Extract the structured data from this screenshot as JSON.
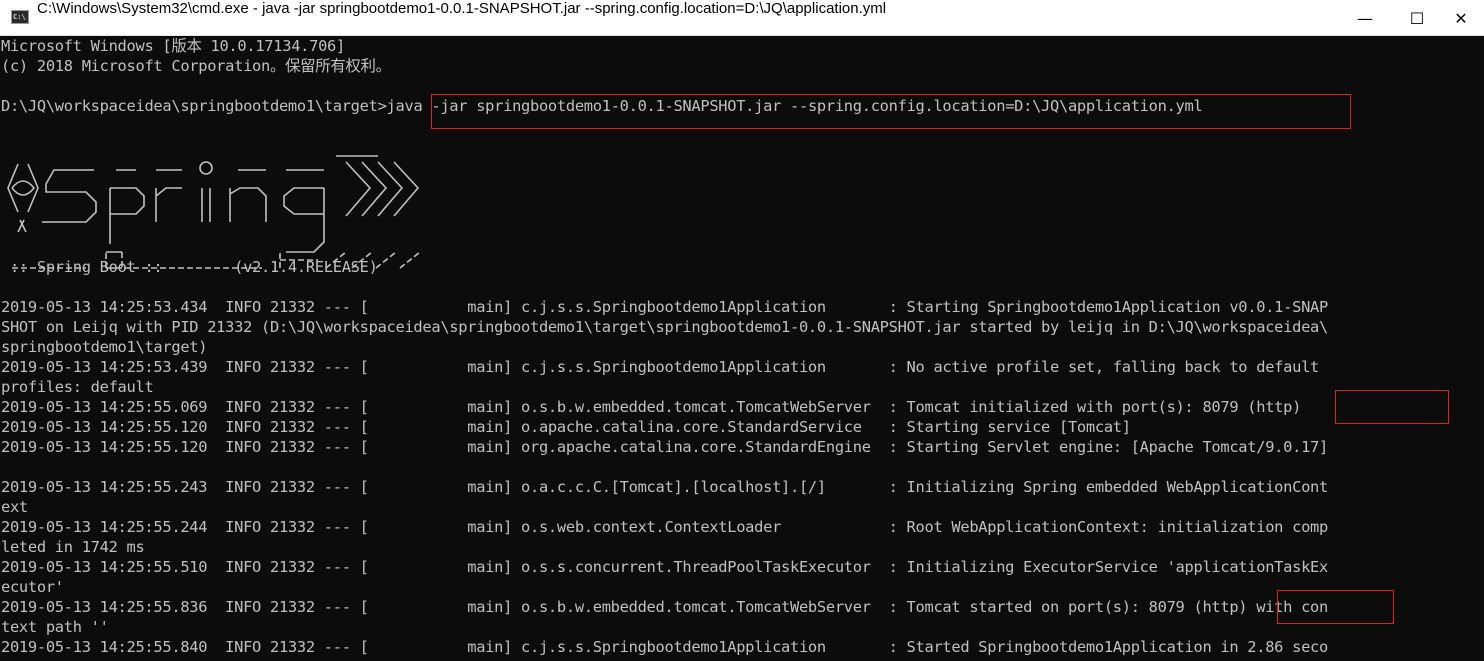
{
  "window": {
    "title": "C:\\Windows\\System32\\cmd.exe - java  -jar springbootdemo1-0.0.1-SNAPSHOT.jar --spring.config.location=D:\\JQ\\application.yml",
    "icon": "cmd-icon",
    "controls": {
      "minimize": "—",
      "maximize": "☐",
      "close": "✕"
    }
  },
  "console": {
    "header": [
      "Microsoft Windows [版本 10.0.17134.706]",
      "(c) 2018 Microsoft Corporation。保留所有权利。"
    ],
    "prompt": "D:\\JQ\\workspaceidea\\springbootdemo1\\target>",
    "command": "java -jar springbootdemo1-0.0.1-SNAPSHOT.jar --spring.config.location=D:\\JQ\\application.yml",
    "banner_footer": " :: Spring Boot ::        (v2.1.4.RELEASE)",
    "log_lines": [
      "2019-05-13 14:25:53.434  INFO 21332 --- [           main] c.j.s.s.Springbootdemo1Application       : Starting Springbootdemo1Application v0.0.1-SNAP",
      "SHOT on Leijq with PID 21332 (D:\\JQ\\workspaceidea\\springbootdemo1\\target\\springbootdemo1-0.0.1-SNAPSHOT.jar started by leijq in D:\\JQ\\workspaceidea\\",
      "springbootdemo1\\target)",
      "2019-05-13 14:25:53.439  INFO 21332 --- [           main] c.j.s.s.Springbootdemo1Application       : No active profile set, falling back to default",
      "profiles: default",
      "2019-05-13 14:25:55.069  INFO 21332 --- [           main] o.s.b.w.embedded.tomcat.TomcatWebServer  : Tomcat initialized with port(s): 8079 (http)",
      "2019-05-13 14:25:55.120  INFO 21332 --- [           main] o.apache.catalina.core.StandardService   : Starting service [Tomcat]",
      "2019-05-13 14:25:55.120  INFO 21332 --- [           main] org.apache.catalina.core.StandardEngine  : Starting Servlet engine: [Apache Tomcat/9.0.17]",
      "",
      "2019-05-13 14:25:55.243  INFO 21332 --- [           main] o.a.c.c.C.[Tomcat].[localhost].[/]       : Initializing Spring embedded WebApplicationCont",
      "ext",
      "2019-05-13 14:25:55.244  INFO 21332 --- [           main] o.s.web.context.ContextLoader            : Root WebApplicationContext: initialization comp",
      "leted in 1742 ms",
      "2019-05-13 14:25:55.510  INFO 21332 --- [           main] o.s.s.concurrent.ThreadPoolTaskExecutor  : Initializing ExecutorService 'applicationTaskEx",
      "ecutor'",
      "2019-05-13 14:25:55.836  INFO 21332 --- [           main] o.s.b.w.embedded.tomcat.TomcatWebServer  : Tomcat started on port(s): 8079 (http) with con",
      "text path ''",
      "2019-05-13 14:25:55.840  INFO 21332 --- [           main] c.j.s.s.Springbootdemo1Application       : Started Springbootdemo1Application in 2.86 seco"
    ],
    "colors": {
      "background": "#0c0c0c",
      "text": "#c0c0c0",
      "highlight_box": "#e02020"
    }
  }
}
